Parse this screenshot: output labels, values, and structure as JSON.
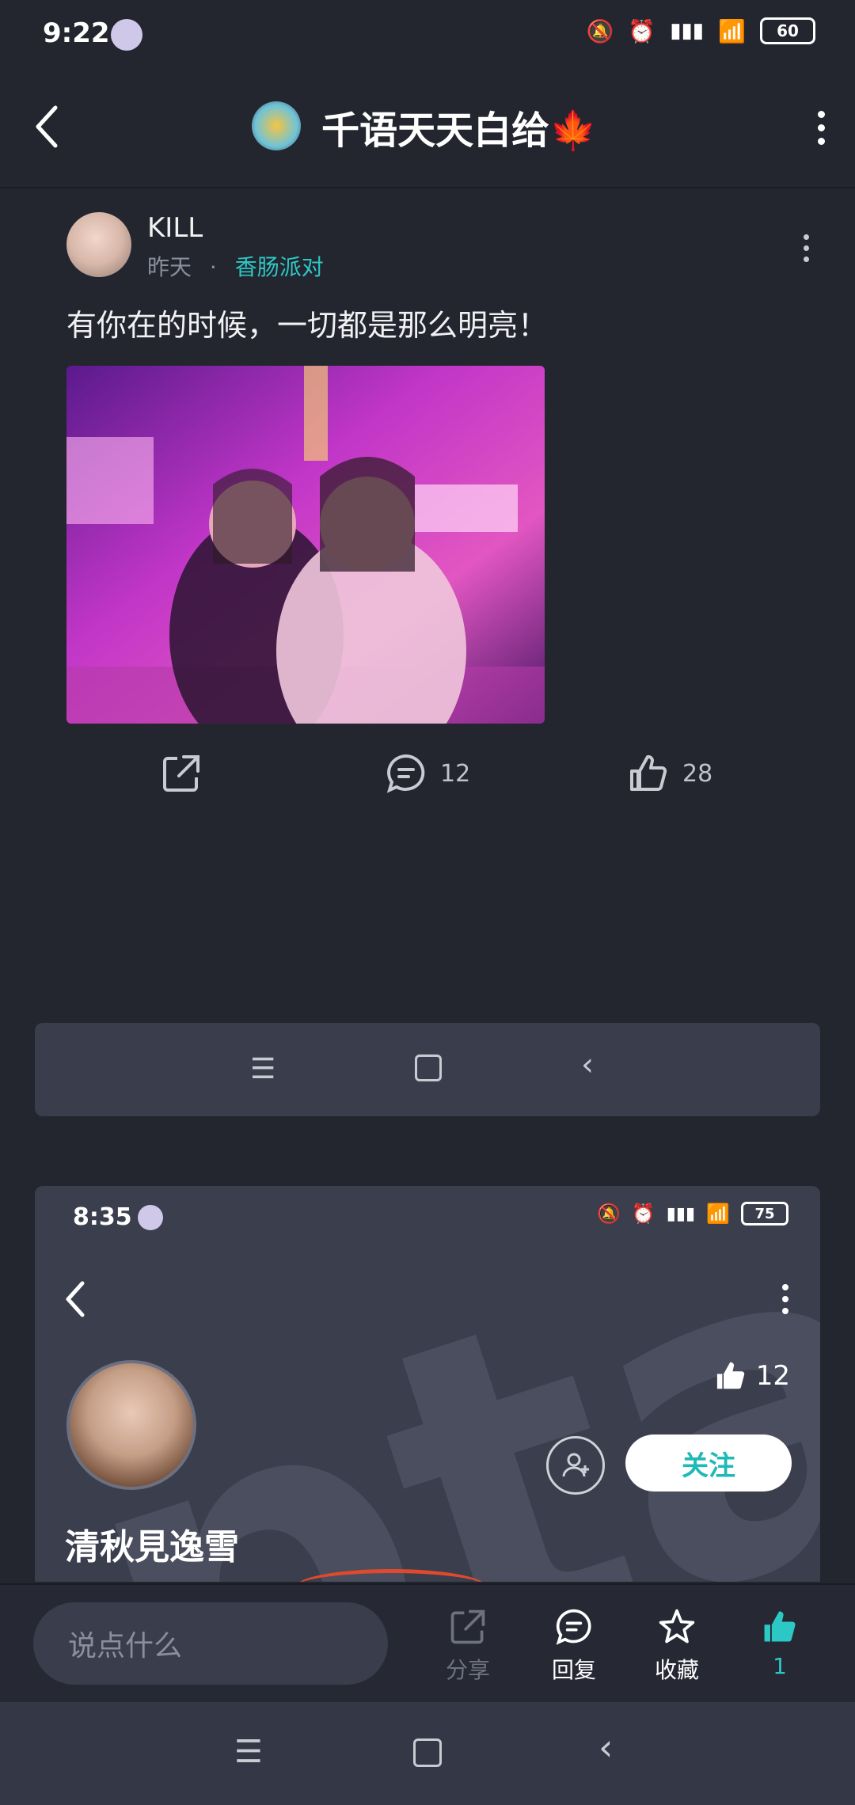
{
  "status_bar": {
    "time": "9:22",
    "battery": "60"
  },
  "header": {
    "title": "千语天天白给🍁"
  },
  "post": {
    "username": "KILL",
    "time": "昨天",
    "separator": "·",
    "topic": "香肠派对",
    "text": "有你在的时候，一切都是那么明亮！",
    "comments_count": "12",
    "likes_count": "28"
  },
  "embedded": {
    "time": "8:35",
    "battery": "75",
    "like_count": "12",
    "follow_label": "关注",
    "profile_name": "清秋見逸雪"
  },
  "bottom_bar": {
    "comment_placeholder": "说点什么",
    "share_label": "分享",
    "reply_label": "回复",
    "favorite_label": "收藏",
    "like_count": "1"
  },
  "colors": {
    "accent": "#2cc8c5",
    "background": "#23252f"
  }
}
